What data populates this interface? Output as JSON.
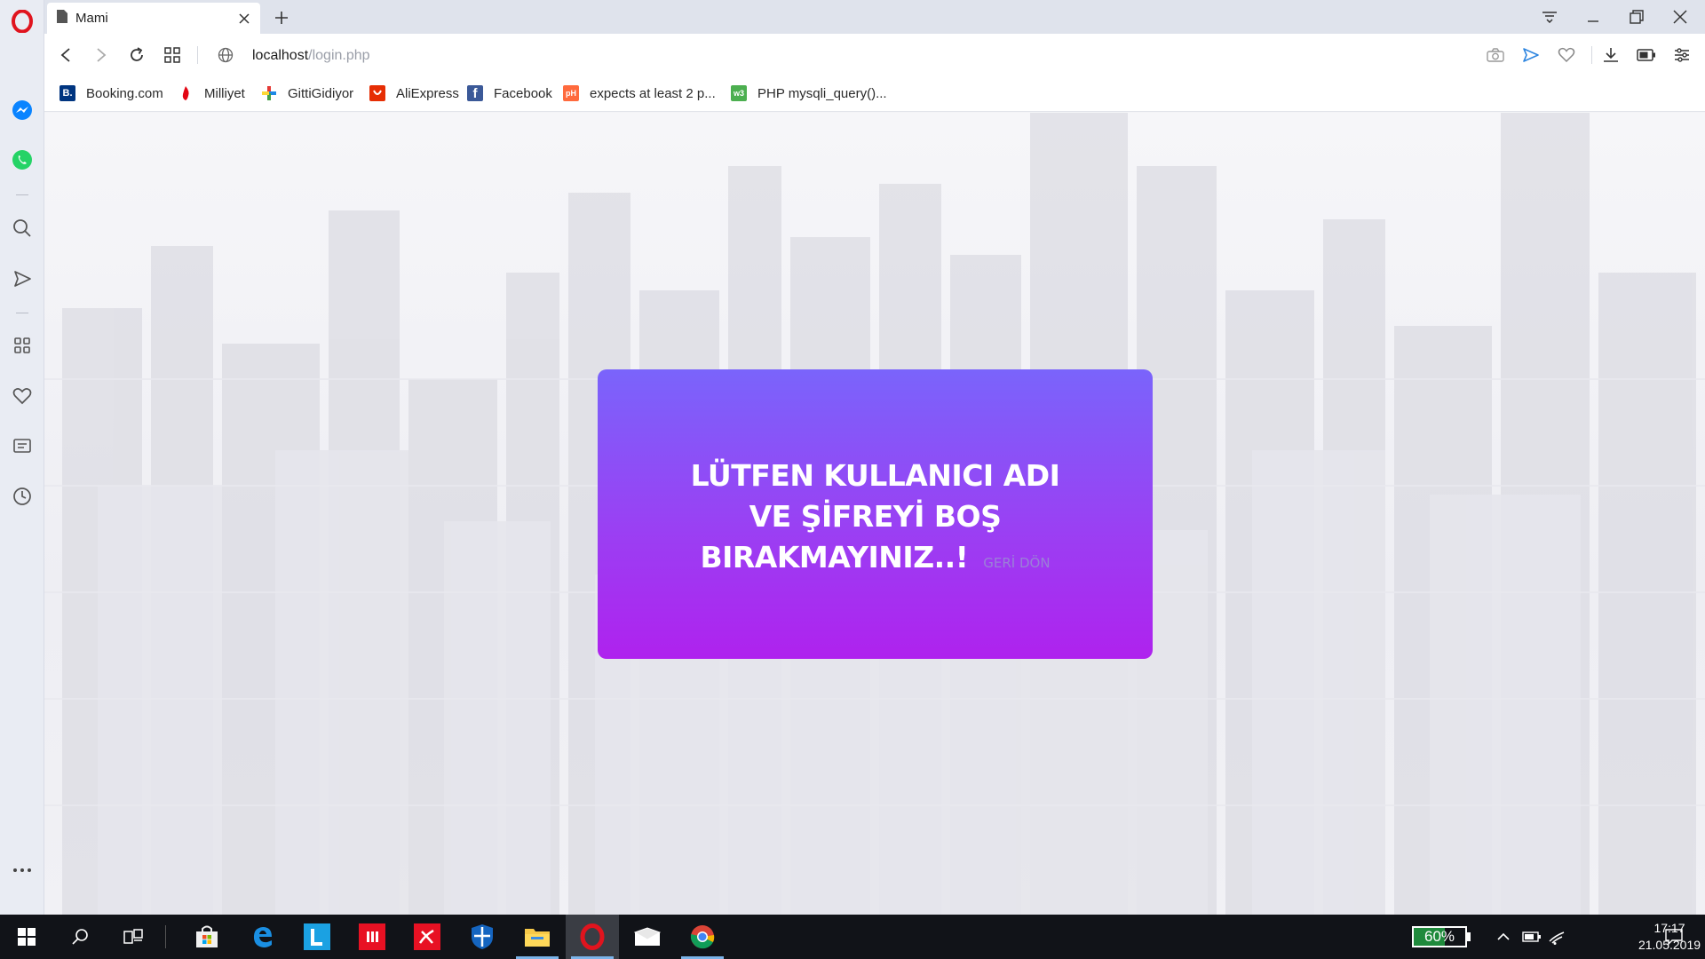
{
  "browser": {
    "tab_title": "Mami",
    "url_host": "localhost",
    "url_path": "/login.php"
  },
  "bookmarks": [
    {
      "label": "Booking.com",
      "icon": "booking-icon",
      "color": "#003580",
      "glyph": "B."
    },
    {
      "label": "Milliyet",
      "icon": "milliyet-icon",
      "color": "#e30613",
      "glyph": "♦"
    },
    {
      "label": "GittiGidiyor",
      "icon": "gittigidiyor-icon",
      "color": "#ffffff",
      "glyph": "✚"
    },
    {
      "label": "AliExpress",
      "icon": "aliexpress-icon",
      "color": "#e62e04",
      "glyph": "◡"
    },
    {
      "label": "Facebook",
      "icon": "facebook-icon",
      "color": "#3b5998",
      "glyph": "f"
    },
    {
      "label": "expects at least 2 p...",
      "icon": "php-net-icon",
      "color": "#ff6a3d",
      "glyph": "pH"
    },
    {
      "label": "PHP mysqli_query()...",
      "icon": "w3schools-icon",
      "color": "#4caf50",
      "glyph": "w3"
    }
  ],
  "page": {
    "message": "LÜTFEN KULLANICI ADI VE ŞİFREYİ BOŞ BIRAKMAYINIZ..!",
    "back_link": "GERİ DÖN"
  },
  "taskbar": {
    "battery": "60%",
    "time": "17:17",
    "date": "21.05.2019"
  },
  "colors": {
    "card_top": "#7a64fb",
    "card_bottom": "#af22ee",
    "opera_red": "#e0141e"
  }
}
